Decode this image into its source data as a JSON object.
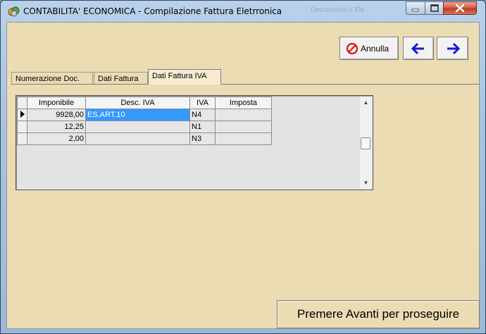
{
  "window": {
    "title": "CONTABILITA' ECONOMICA - Compilazione Fattura Eletrronica",
    "background_title": "Documento II  Ele...",
    "accent": "#3399ff",
    "panel_color": "#ecdcb4"
  },
  "toolbar": {
    "annulla_label": "Annulla",
    "prev_icon": "arrow-left-icon",
    "next_icon": "arrow-right-icon"
  },
  "tabs": [
    {
      "label": "Numerazione Doc."
    },
    {
      "label": "Dati Fattura"
    },
    {
      "label": "Dati Fattura IVA"
    }
  ],
  "grid": {
    "columns": [
      "Imponibile",
      "Desc. IVA",
      "IVA",
      "Imposta"
    ],
    "rows": [
      {
        "imponibile": "9928,00",
        "desc": "ES.ART.10",
        "iva": "N4",
        "imposta": ""
      },
      {
        "imponibile": "12,25",
        "desc": "",
        "iva": "N1",
        "imposta": ""
      },
      {
        "imponibile": "2,00",
        "desc": "",
        "iva": "N3",
        "imposta": ""
      }
    ]
  },
  "status": {
    "message": "Premere Avanti per proseguire"
  }
}
